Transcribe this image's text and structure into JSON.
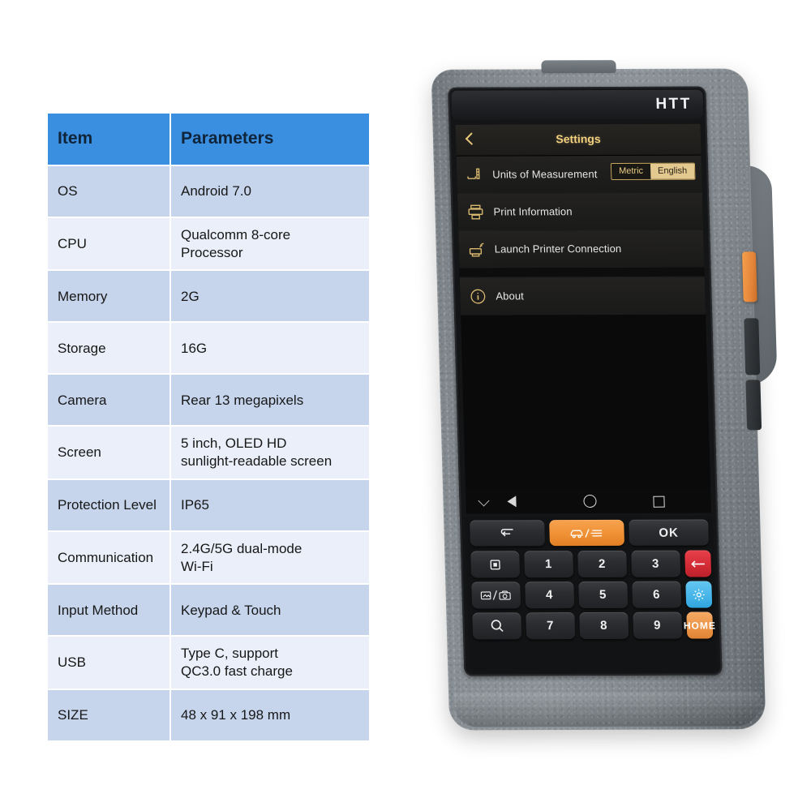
{
  "spec_table": {
    "headers": [
      "Item",
      "Parameters"
    ],
    "rows": [
      {
        "item": "OS",
        "params": [
          "Android 7.0"
        ]
      },
      {
        "item": "CPU",
        "params": [
          "Qualcomm 8-core",
          "Processor"
        ]
      },
      {
        "item": "Memory",
        "params": [
          "2G"
        ]
      },
      {
        "item": "Storage",
        "params": [
          "16G"
        ]
      },
      {
        "item": "Camera",
        "params": [
          "Rear 13 megapixels"
        ]
      },
      {
        "item": "Screen",
        "params": [
          "5 inch, OLED HD",
          "sunlight-readable screen"
        ]
      },
      {
        "item": "Protection Level",
        "params": [
          "IP65"
        ]
      },
      {
        "item": "Communication",
        "params": [
          "2.4G/5G dual-mode",
          "Wi-Fi"
        ]
      },
      {
        "item": "Input Method",
        "params": [
          "Keypad & Touch"
        ]
      },
      {
        "item": "USB",
        "params": [
          "Type C, support",
          "QC3.0 fast charge"
        ]
      },
      {
        "item": "SIZE",
        "params": [
          "48 x 91 x 198 mm"
        ]
      }
    ],
    "colors": {
      "header_bg": "#3b8fe0",
      "row_dark_bg": "#c6d5ec",
      "row_light_bg": "#eaeff9",
      "text": "#171717"
    }
  },
  "device": {
    "brand": "HTT",
    "body_color": "#8d9499",
    "screen": {
      "appbar": {
        "back_icon": "chevron-left-icon",
        "title": "Settings",
        "accent": "#f2d07e"
      },
      "list": [
        {
          "icon": "ruler-measure-icon",
          "label": "Units of Measurement",
          "toggle": {
            "options": [
              "Metric",
              "English"
            ],
            "selected": "English"
          }
        },
        {
          "icon": "printer-icon",
          "label": "Print Information"
        },
        {
          "icon": "printer-wifi-icon",
          "label": "Launch Printer Connection"
        },
        {
          "icon": "info-circle-icon",
          "label": "About"
        }
      ],
      "navbar": [
        {
          "icon": "chevron-down-icon",
          "name": "hide-navbar"
        },
        {
          "icon": "triangle-back-icon",
          "name": "back"
        },
        {
          "icon": "circle-home-icon",
          "name": "home"
        },
        {
          "icon": "square-recents-icon",
          "name": "recents"
        }
      ]
    },
    "keypad": {
      "fn_row": [
        {
          "label": "",
          "icon": "return-arrow-icon",
          "style": "dark"
        },
        {
          "label": "",
          "icon": "vehicle-list-icon",
          "style": "orange"
        },
        {
          "label": "OK",
          "icon": "",
          "style": "dark"
        }
      ],
      "left_column": [
        {
          "label": "",
          "icon": "stop-square-icon"
        },
        {
          "label": "",
          "icon": "photo-camera-switch-icon"
        },
        {
          "label": "",
          "icon": "magnifier-icon"
        }
      ],
      "digits": [
        "1",
        "2",
        "3",
        "4",
        "5",
        "6",
        "7",
        "8",
        "9"
      ],
      "right_column": [
        {
          "label": "",
          "icon": "backspace-arrow-icon",
          "style": "red"
        },
        {
          "label": "",
          "icon": "gear-icon",
          "style": "blue"
        },
        {
          "label": "HOME",
          "icon": "",
          "style": "home-orange"
        }
      ]
    },
    "side_buttons": [
      {
        "name": "scan-trigger-button",
        "color": "#e5863a"
      },
      {
        "name": "side-button-upper",
        "color": "#2f3336"
      },
      {
        "name": "side-button-lower",
        "color": "#2f3336"
      }
    ]
  }
}
